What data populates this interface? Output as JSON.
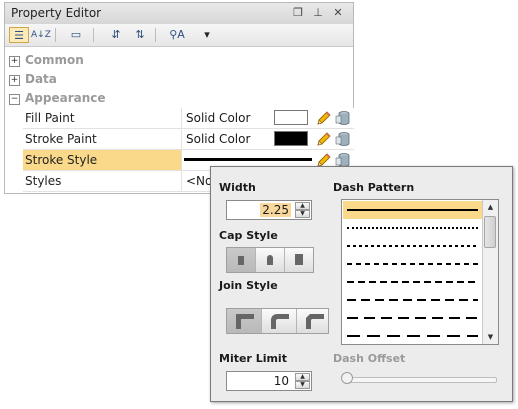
{
  "window": {
    "title": "Property Editor",
    "controls": {
      "restore_glyph": "❐",
      "pin_glyph": "⊥",
      "close_glyph": "✕"
    }
  },
  "toolbar": {
    "categorized_glyph": "☰",
    "sort_glyph": "A↓Z",
    "show_glyph": "▭",
    "expand_glyph": "⇵",
    "collapse_glyph": "⇅",
    "filter_glyph": "⚲A",
    "dropdown_glyph": "▾"
  },
  "categories": [
    {
      "label": "Common",
      "expander": "+"
    },
    {
      "label": "Data",
      "expander": "+"
    },
    {
      "label": "Appearance",
      "expander": "−"
    }
  ],
  "properties": [
    {
      "name": "Fill Paint",
      "value": "Solid Color",
      "swatch": "#ffffff"
    },
    {
      "name": "Stroke Paint",
      "value": "Solid Color",
      "swatch": "#000000"
    },
    {
      "name": "Stroke Style",
      "value": ""
    },
    {
      "name": "Styles",
      "value": "<No"
    }
  ],
  "stroke_popup": {
    "width_label": "Width",
    "width_value": "2.25",
    "cap_label": "Cap Style",
    "join_label": "Join Style",
    "miter_label": "Miter Limit",
    "miter_value": "10",
    "dash_label": "Dash Pattern",
    "dash_offset_label": "Dash Offset",
    "dash_offset_value": 0,
    "dash_patterns": [
      "solid",
      "dotted-fine",
      "dotted",
      "dash-short",
      "dash-medium",
      "dash-long",
      "dash-longer",
      "dash-longest"
    ],
    "selected_dash_index": 0,
    "cap_selected_index": 0,
    "join_selected_index": 0
  },
  "colors": {
    "selection": "#fbd98a",
    "highlight": "#f9d89e",
    "accent_pencil": "#e0a100"
  }
}
